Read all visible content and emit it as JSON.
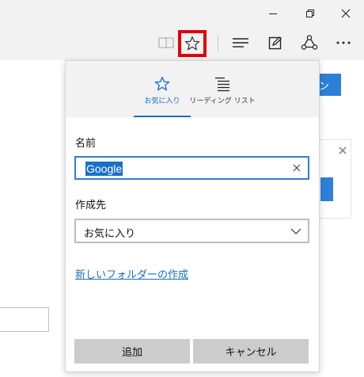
{
  "window": {
    "controls": [
      "minimize-icon",
      "restore-icon",
      "close-icon"
    ]
  },
  "toolbar": {
    "icons": [
      "reading-view-icon",
      "favorites-star-icon",
      "hub-icon",
      "web-note-icon",
      "share-icon",
      "more-icon"
    ],
    "highlight_color": "#e0000d"
  },
  "background": {
    "top_button_label": "ン"
  },
  "panel": {
    "tabs": [
      {
        "label": "お気に入り",
        "icon": "star-icon",
        "active": true
      },
      {
        "label": "リーディング リスト",
        "icon": "reading-list-icon",
        "active": false
      }
    ],
    "name_label": "名前",
    "name_value": "Google",
    "destination_label": "作成先",
    "destination_value": "お気に入り",
    "new_folder_link": "新しいフォルダーの作成",
    "add_button": "追加",
    "cancel_button": "キャンセル",
    "accent_color": "#1a6fc7"
  }
}
